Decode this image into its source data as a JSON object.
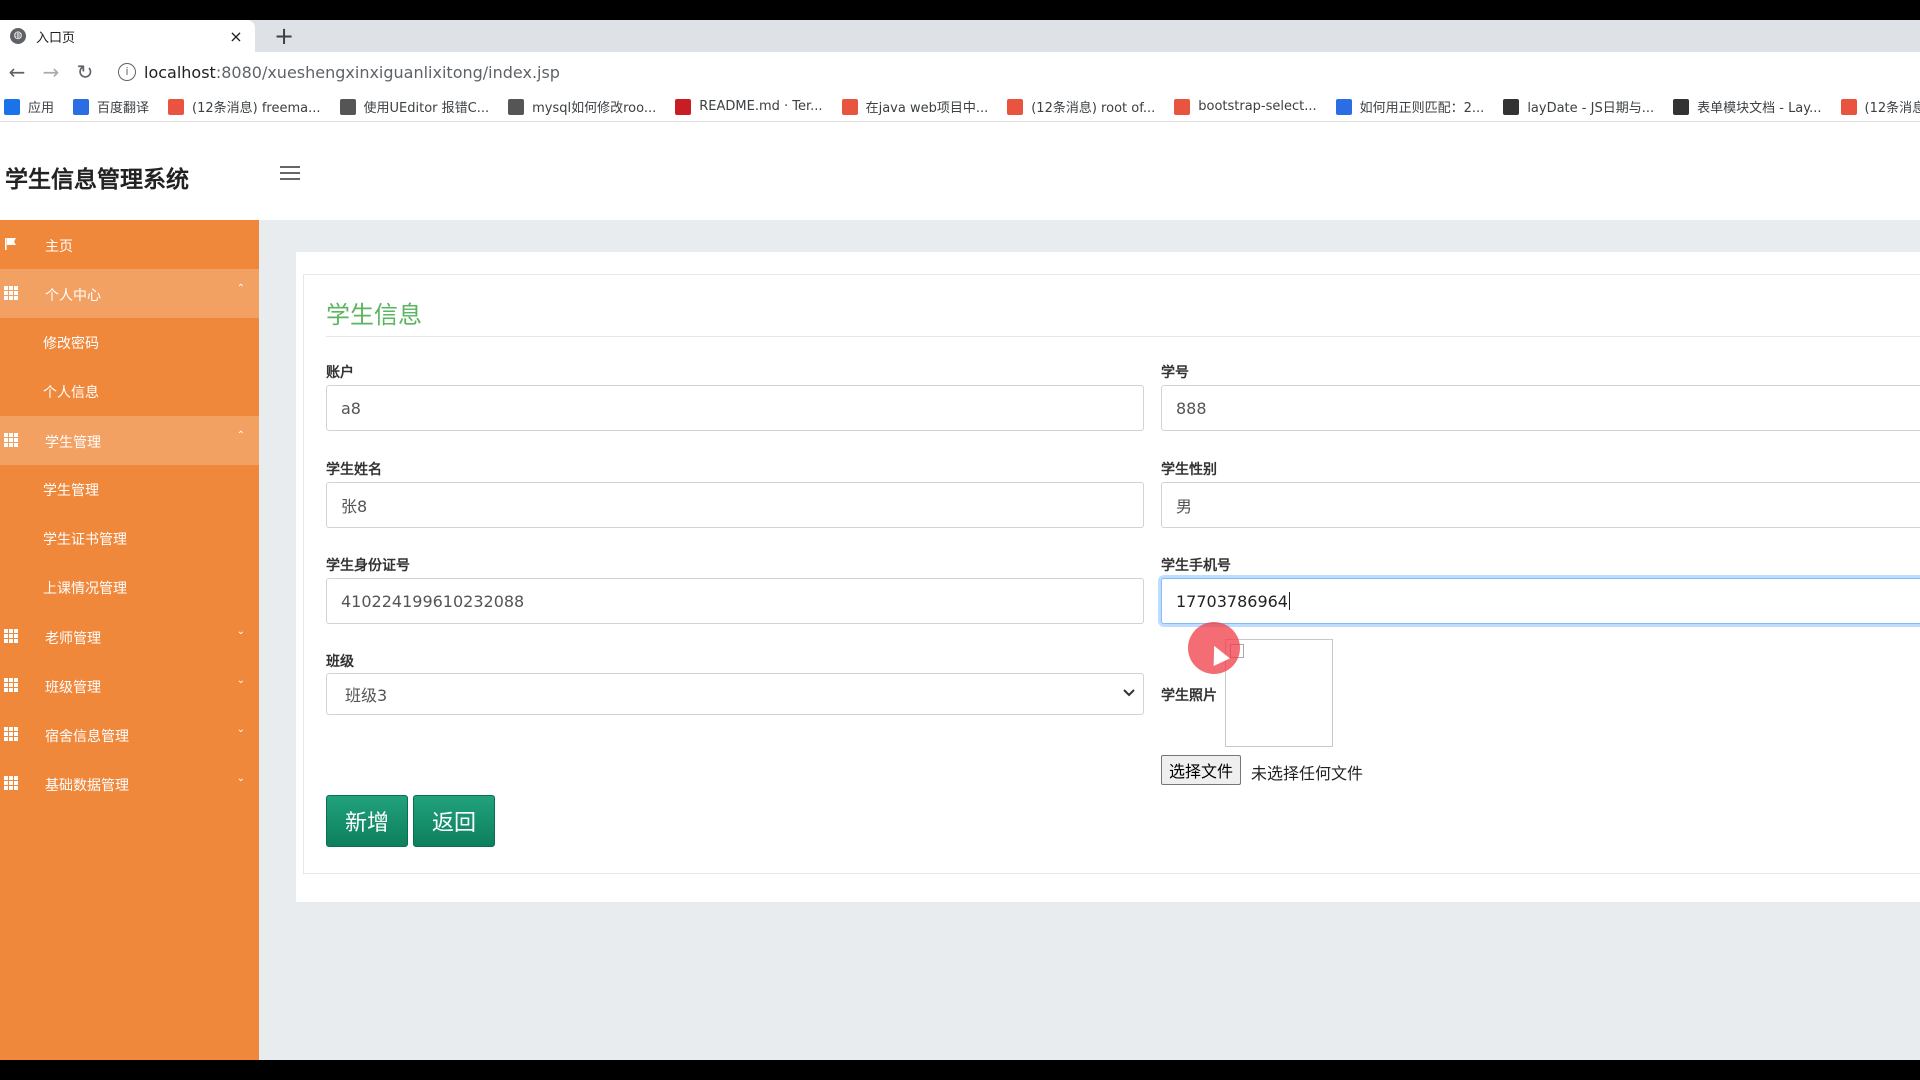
{
  "browser": {
    "tab_title": "入口页",
    "tab_close": "×",
    "new_tab": "+",
    "url_host": "localhost",
    "url_rest": ":8080/xueshengxinxiguanlixitong/index.jsp",
    "bookmarks": [
      {
        "label": "应用",
        "icon": "apps-grid-icon",
        "color": "#1a73e8"
      },
      {
        "label": "百度翻译",
        "icon": "baidu-translate-icon",
        "color": "#2b6de5"
      },
      {
        "label": "(12条消息) freema...",
        "icon": "csdn-icon",
        "color": "#e8543f"
      },
      {
        "label": "使用UEditor 报错C...",
        "icon": "ueditor-icon",
        "color": "#555555"
      },
      {
        "label": "mysql如何修改roo...",
        "icon": "mysql-icon",
        "color": "#555555"
      },
      {
        "label": "README.md · Ter...",
        "icon": "gitee-icon",
        "color": "#c71d23"
      },
      {
        "label": "在java web项目中...",
        "icon": "csdn-icon",
        "color": "#e8543f"
      },
      {
        "label": "(12条消息) root of...",
        "icon": "csdn-icon",
        "color": "#e8543f"
      },
      {
        "label": "bootstrap-select...",
        "icon": "cnblogs-icon",
        "color": "#e8543f"
      },
      {
        "label": "如何用正则匹配：2...",
        "icon": "baidu-paw-icon",
        "color": "#2b6de5"
      },
      {
        "label": "layDate - JS日期与...",
        "icon": "layui-icon",
        "color": "#333333"
      },
      {
        "label": "表单模块文档 - Lay...",
        "icon": "layui-icon",
        "color": "#333333"
      },
      {
        "label": "(12条消息",
        "icon": "csdn-icon",
        "color": "#e8543f"
      }
    ]
  },
  "app": {
    "brand": "学生信息管理系统",
    "colors": {
      "sidebar": "#f0883c",
      "sidebar_open": "#f3a063",
      "title": "#5ab55f",
      "button": "#14906b"
    },
    "sidebar": {
      "home": "主页",
      "personal_center": "个人中心",
      "change_password": "修改密码",
      "personal_info": "个人信息",
      "student_mgmt": "学生管理",
      "student_mgmt_sub": "学生管理",
      "certificate_mgmt": "学生证书管理",
      "attendance_mgmt": "上课情况管理",
      "teacher_mgmt": "老师管理",
      "class_mgmt": "班级管理",
      "dorm_mgmt": "宿舍信息管理",
      "base_data_mgmt": "基础数据管理",
      "arrow_up": "⌃",
      "arrow_down": "⌄"
    },
    "form": {
      "title": "学生信息",
      "account_label": "账户",
      "account_value": "a8",
      "student_no_label": "学号",
      "student_no_value": "888",
      "name_label": "学生姓名",
      "name_value": "张8",
      "gender_label": "学生性别",
      "gender_value": "男",
      "id_card_label": "学生身份证号",
      "id_card_value": "410224199610232088",
      "phone_label": "学生手机号",
      "phone_value": "17703786964",
      "class_label": "班级",
      "class_value": "班级3",
      "photo_label": "学生照片",
      "file_button": "选择文件",
      "file_status": "未选择任何文件",
      "add_button": "新增",
      "back_button": "返回"
    }
  }
}
